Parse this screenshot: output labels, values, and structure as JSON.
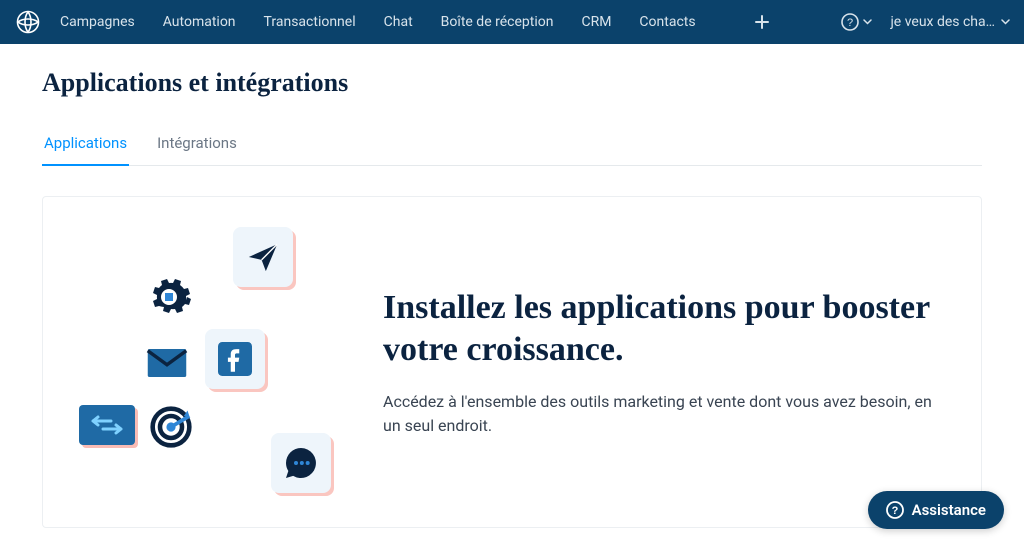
{
  "nav": {
    "items": [
      "Campagnes",
      "Automation",
      "Transactionnel",
      "Chat",
      "Boîte de réception",
      "CRM",
      "Contacts"
    ],
    "account_label": "je veux des cha…"
  },
  "page": {
    "title": "Applications et intégrations"
  },
  "tabs": [
    {
      "label": "Applications",
      "active": true
    },
    {
      "label": "Intégrations",
      "active": false
    }
  ],
  "hero": {
    "heading": "Installez les applications pour booster votre croissance.",
    "sub": "Accédez à l'ensemble des outils marketing et vente dont vous avez besoin, en un seul endroit."
  },
  "assistance": {
    "label": "Assistance"
  }
}
